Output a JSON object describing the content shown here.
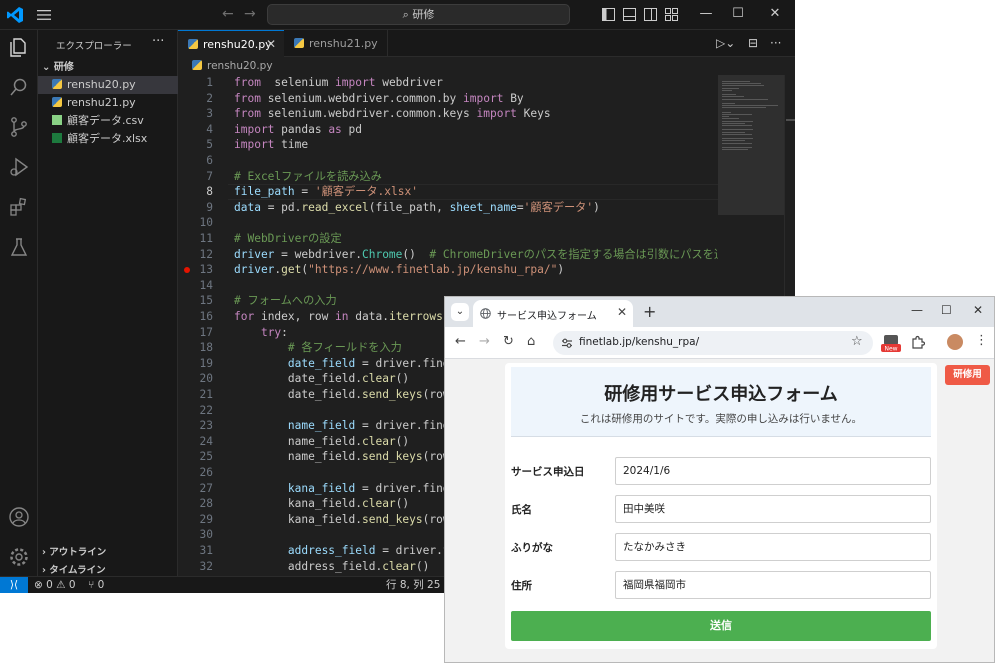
{
  "vscode": {
    "search_text": "研修",
    "explorer_title": "エクスプローラー",
    "folder_name": "研修",
    "files": [
      {
        "name": "renshu20.py",
        "type": "python"
      },
      {
        "name": "renshu21.py",
        "type": "python"
      },
      {
        "name": "顧客データ.csv",
        "type": "csv"
      },
      {
        "name": "顧客データ.xlsx",
        "type": "excel"
      }
    ],
    "outline_label": "アウトライン",
    "timeline_label": "タイムライン",
    "tabs": [
      {
        "label": "renshu20.py"
      },
      {
        "label": "renshu21.py"
      }
    ],
    "breadcrumb": "renshu20.py",
    "status": {
      "errors_warnings": "⊗ 0 ⚠ 0",
      "ports": "⑂ 0",
      "cursor": "行 8, 列 25"
    },
    "code_lines": [
      {
        "n": "1",
        "t": [
          [
            "kw",
            "from"
          ],
          [
            "",
            "  selenium "
          ],
          [
            "kw",
            "import"
          ],
          [
            "",
            " webdriver"
          ]
        ]
      },
      {
        "n": "2",
        "t": [
          [
            "kw",
            "from"
          ],
          [
            "",
            " selenium.webdriver.common.by "
          ],
          [
            "kw",
            "import"
          ],
          [
            "",
            " By"
          ]
        ]
      },
      {
        "n": "3",
        "t": [
          [
            "kw",
            "from"
          ],
          [
            "",
            " selenium.webdriver.common.keys "
          ],
          [
            "kw",
            "import"
          ],
          [
            "",
            " Keys"
          ]
        ]
      },
      {
        "n": "4",
        "t": [
          [
            "kw",
            "import"
          ],
          [
            "",
            " pandas "
          ],
          [
            "kw",
            "as"
          ],
          [
            "",
            " pd"
          ]
        ]
      },
      {
        "n": "5",
        "t": [
          [
            "kw",
            "import"
          ],
          [
            "",
            " time"
          ]
        ]
      },
      {
        "n": "6",
        "t": []
      },
      {
        "n": "7",
        "t": [
          [
            "cm",
            "# Excelファイルを読み込み"
          ]
        ]
      },
      {
        "n": "8",
        "t": [
          [
            "var",
            "file_path"
          ],
          [
            "",
            " = "
          ],
          [
            "str",
            "'顧客データ.xlsx'"
          ]
        ]
      },
      {
        "n": "9",
        "t": [
          [
            "var",
            "data"
          ],
          [
            "",
            " = pd."
          ],
          [
            "fn",
            "read_excel"
          ],
          [
            "",
            "(file_path, "
          ],
          [
            "var",
            "sheet_name"
          ],
          [
            "",
            "="
          ],
          [
            "str",
            "'顧客データ'"
          ],
          [
            "",
            ")"
          ]
        ]
      },
      {
        "n": "10",
        "t": []
      },
      {
        "n": "11",
        "t": [
          [
            "cm",
            "# WebDriverの設定"
          ]
        ]
      },
      {
        "n": "12",
        "t": [
          [
            "var",
            "driver"
          ],
          [
            "",
            " = webdriver."
          ],
          [
            "cls",
            "Chrome"
          ],
          [
            "",
            "()  "
          ],
          [
            "cm",
            "# ChromeDriverのパスを指定する場合は引数にパスを追加"
          ]
        ]
      },
      {
        "n": "13",
        "t": [
          [
            "var",
            "driver"
          ],
          [
            "",
            "."
          ],
          [
            "fn",
            "get"
          ],
          [
            "",
            "("
          ],
          [
            "str",
            "\"https://www.finetlab.jp/kenshu_rpa/\""
          ],
          [
            "",
            ")"
          ]
        ]
      },
      {
        "n": "14",
        "t": []
      },
      {
        "n": "15",
        "t": [
          [
            "cm",
            "# フォームへの入力"
          ]
        ]
      },
      {
        "n": "16",
        "t": [
          [
            "kw",
            "for"
          ],
          [
            "",
            " index, row "
          ],
          [
            "kw",
            "in"
          ],
          [
            "",
            " data."
          ],
          [
            "fn",
            "iterrows"
          ],
          [
            "",
            "()"
          ]
        ]
      },
      {
        "n": "17",
        "t": [
          [
            "",
            "    "
          ],
          [
            "kw",
            "try"
          ],
          [
            "",
            ":"
          ]
        ]
      },
      {
        "n": "18",
        "t": [
          [
            "",
            "        "
          ],
          [
            "cm",
            "# 各フィールドを入力"
          ]
        ]
      },
      {
        "n": "19",
        "t": [
          [
            "",
            "        "
          ],
          [
            "var",
            "date_field"
          ],
          [
            "",
            " = driver.find_e"
          ]
        ]
      },
      {
        "n": "20",
        "t": [
          [
            "",
            "        date_field."
          ],
          [
            "fn",
            "clear"
          ],
          [
            "",
            "()"
          ]
        ]
      },
      {
        "n": "21",
        "t": [
          [
            "",
            "        date_field."
          ],
          [
            "fn",
            "send_keys"
          ],
          [
            "",
            "(row["
          ]
        ]
      },
      {
        "n": "22",
        "t": []
      },
      {
        "n": "23",
        "t": [
          [
            "",
            "        "
          ],
          [
            "var",
            "name_field"
          ],
          [
            "",
            " = driver.find_e"
          ]
        ]
      },
      {
        "n": "24",
        "t": [
          [
            "",
            "        name_field."
          ],
          [
            "fn",
            "clear"
          ],
          [
            "",
            "()"
          ]
        ]
      },
      {
        "n": "25",
        "t": [
          [
            "",
            "        name_field."
          ],
          [
            "fn",
            "send_keys"
          ],
          [
            "",
            "(row["
          ]
        ]
      },
      {
        "n": "26",
        "t": []
      },
      {
        "n": "27",
        "t": [
          [
            "",
            "        "
          ],
          [
            "var",
            "kana_field"
          ],
          [
            "",
            " = driver.find_e"
          ]
        ]
      },
      {
        "n": "28",
        "t": [
          [
            "",
            "        kana_field."
          ],
          [
            "fn",
            "clear"
          ],
          [
            "",
            "()"
          ]
        ]
      },
      {
        "n": "29",
        "t": [
          [
            "",
            "        kana_field."
          ],
          [
            "fn",
            "send_keys"
          ],
          [
            "",
            "(row["
          ]
        ]
      },
      {
        "n": "30",
        "t": []
      },
      {
        "n": "31",
        "t": [
          [
            "",
            "        "
          ],
          [
            "var",
            "address_field"
          ],
          [
            "",
            " = driver.fi"
          ]
        ]
      },
      {
        "n": "32",
        "t": [
          [
            "",
            "        address_field."
          ],
          [
            "fn",
            "clear"
          ],
          [
            "",
            "()"
          ]
        ]
      }
    ]
  },
  "chrome": {
    "tab_title": "サービス申込フォーム",
    "url": "finetlab.jp/kenshu_rpa/",
    "new_badge": "New",
    "corner_badge": "研修用",
    "form": {
      "title": "研修用サービス申込フォーム",
      "subtitle": "これは研修用のサイトです。実際の申し込みは行いません。",
      "fields": [
        {
          "label": "サービス申込日",
          "value": "2024/1/6"
        },
        {
          "label": "氏名",
          "value": "田中美咲"
        },
        {
          "label": "ふりがな",
          "value": "たなかみさき"
        },
        {
          "label": "住所",
          "value": "福岡県福岡市"
        }
      ],
      "submit_label": "送信"
    }
  },
  "colors": {
    "vscode_bg": "#1f1f1f",
    "accent": "#0078d4",
    "submit": "#4caf50",
    "badge": "#ef5a46",
    "breakpoint": "#e51400"
  }
}
